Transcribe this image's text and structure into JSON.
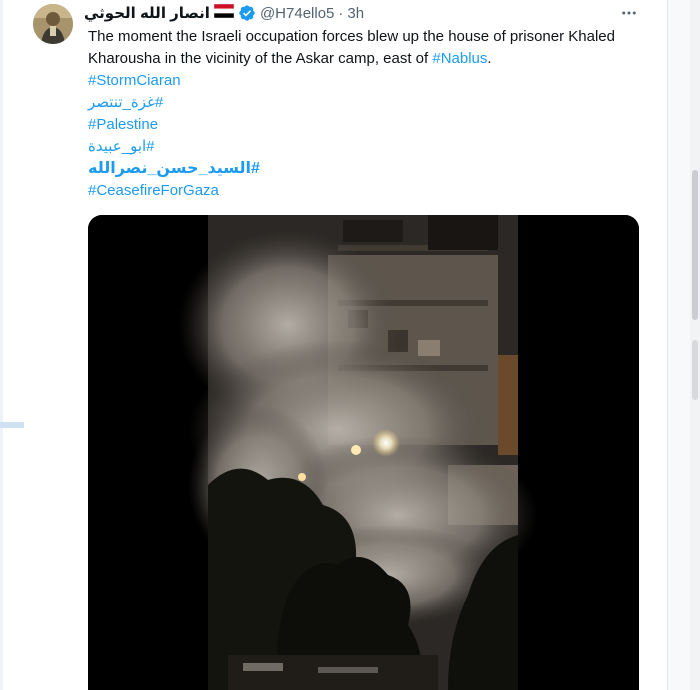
{
  "tweet": {
    "display_name": "انصار الله الحوثي",
    "flag": "yemen-flag",
    "verified": "verified-badge",
    "handle": "@H74ello5",
    "separator": "·",
    "time": "3h",
    "text_prefix": "The moment the Israeli occupation forces blew up the house of prisoner Khaled Kharousha in the vicinity of the Askar camp, east of ",
    "text_link": "#Nablus",
    "text_suffix": ".",
    "hashtags": [
      "#StormCiaran",
      "#غزة_تنتصر",
      "#Palestine",
      "#ابو_عبيدة",
      "#السيد_حسن_نصرالله",
      "#CeasefireForGaza"
    ],
    "media": {
      "type": "video",
      "description_icon": "video-frame"
    }
  },
  "colors": {
    "link": "#1d9bf0",
    "text": "#0f1419",
    "muted": "#536471"
  },
  "icons": {
    "more": "more-options-icon",
    "verified": "verified-icon",
    "flag": "flag-icon"
  }
}
